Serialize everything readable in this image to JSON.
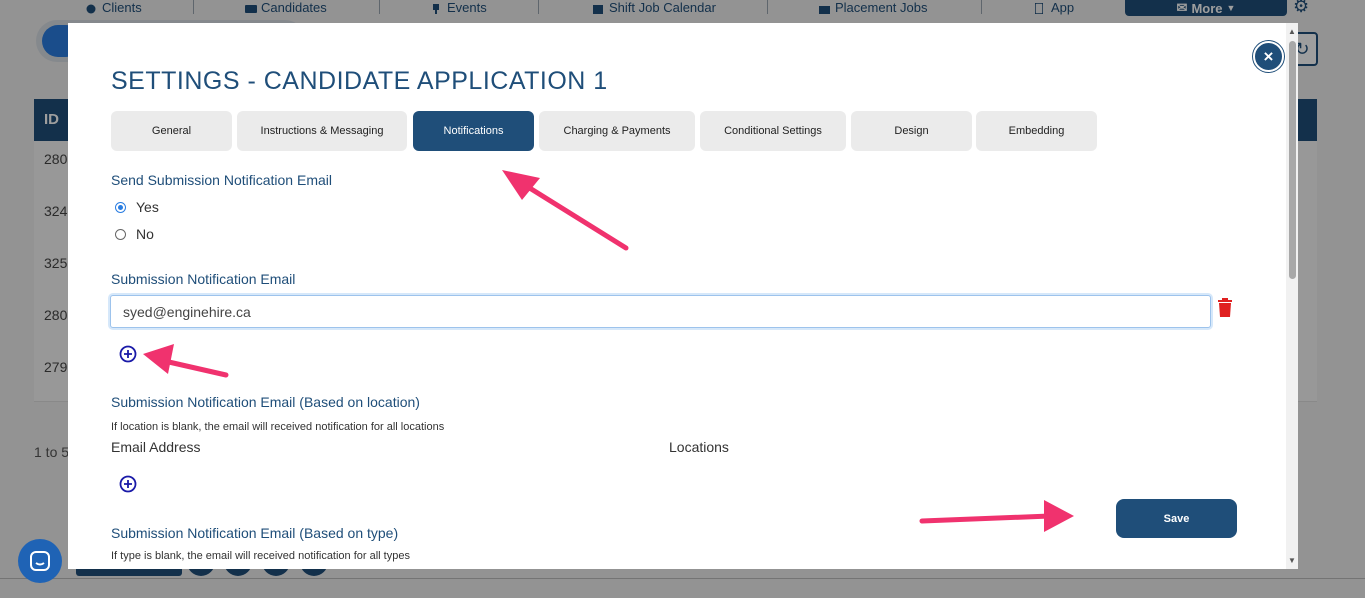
{
  "topnav": {
    "items": [
      {
        "label": "Clients",
        "icon": "globe-icon"
      },
      {
        "label": "Candidates",
        "icon": "id-card-icon"
      },
      {
        "label": "Events",
        "icon": "trophy-icon"
      },
      {
        "label": "Shift Job Calendar",
        "icon": "calendar-icon"
      },
      {
        "label": "Placement Jobs",
        "icon": "briefcase-icon"
      },
      {
        "label": "App",
        "icon": "phone-icon"
      }
    ],
    "more_label": "More",
    "settings_icon": "gear-icon"
  },
  "table": {
    "header_id": "ID",
    "rows": [
      "280",
      "324",
      "325",
      "280",
      "279"
    ],
    "pager": "1 to 5"
  },
  "modal": {
    "title": "SETTINGS - CANDIDATE APPLICATION 1",
    "close_label": "×",
    "tabs": [
      {
        "label": "General",
        "active": false
      },
      {
        "label": "Instructions & Messaging",
        "active": false
      },
      {
        "label": "Notifications",
        "active": true
      },
      {
        "label": "Charging & Payments",
        "active": false
      },
      {
        "label": "Conditional Settings",
        "active": false
      },
      {
        "label": "Design",
        "active": false
      },
      {
        "label": "Embedding",
        "active": false
      }
    ],
    "send_notification": {
      "label": "Send Submission Notification Email",
      "options": [
        {
          "label": "Yes",
          "checked": true
        },
        {
          "label": "No",
          "checked": false
        }
      ]
    },
    "notification_email": {
      "label": "Submission Notification Email",
      "value": "syed@enginehire.ca"
    },
    "by_location": {
      "label": "Submission Notification Email (Based on location)",
      "helper": "If location is blank, the email will received notification for all locations",
      "col_email": "Email Address",
      "col_locations": "Locations"
    },
    "by_type": {
      "label": "Submission Notification Email (Based on type)",
      "helper": "If type is blank, the email will received notification for all types"
    },
    "save_label": "Save"
  },
  "colors": {
    "primary": "#1f4e79",
    "accent_blue": "#2a7de1",
    "danger": "#e02020",
    "annotation_arrow": "#f0326e"
  }
}
